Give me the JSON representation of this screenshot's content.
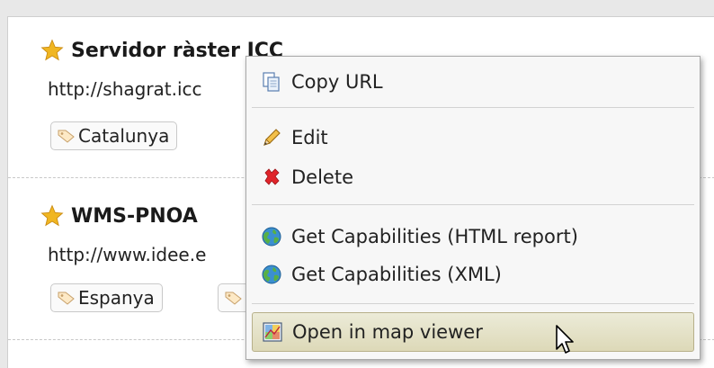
{
  "entries": [
    {
      "title": "Servidor ràster ICC",
      "url": "http://shagrat.icc",
      "tags": [
        "Catalunya"
      ]
    },
    {
      "title": "WMS-PNOA",
      "url": "http://www.idee.e",
      "tags": [
        "Espanya",
        ""
      ]
    }
  ],
  "context_menu": {
    "items": [
      {
        "label": "Copy URL",
        "icon": "copy-icon"
      },
      {
        "label": "Edit",
        "icon": "pencil-icon"
      },
      {
        "label": "Delete",
        "icon": "delete-x-icon"
      },
      {
        "label": "Get Capabilities (HTML report)",
        "icon": "globe-icon"
      },
      {
        "label": "Get Capabilities (XML)",
        "icon": "globe-icon"
      },
      {
        "label": "Open in map viewer",
        "icon": "map-icon"
      }
    ],
    "highlighted_item": "Open in map viewer"
  },
  "colors": {
    "star": "#f0b622",
    "delete": "#e0242a",
    "globe": "#3b8fd0",
    "highlight": "#ddd9b8"
  }
}
